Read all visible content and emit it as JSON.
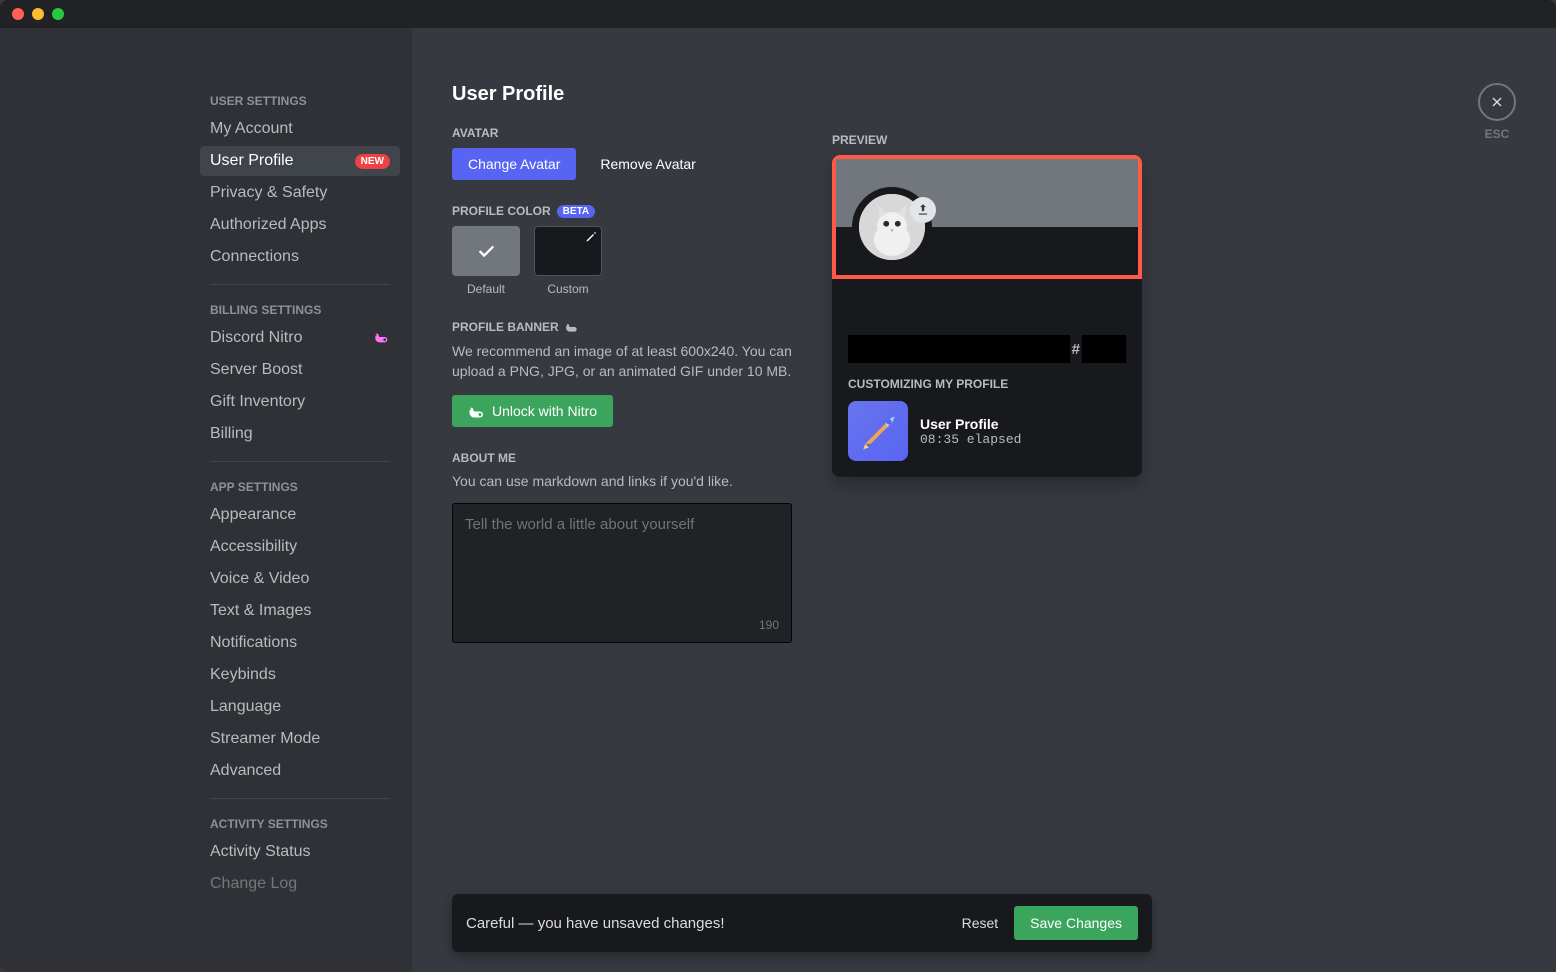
{
  "sidebar": {
    "sections": [
      {
        "header": "User Settings",
        "items": [
          {
            "label": "My Account",
            "key": "my-account"
          },
          {
            "label": "User Profile",
            "key": "user-profile",
            "selected": true,
            "badge": "NEW"
          },
          {
            "label": "Privacy & Safety",
            "key": "privacy-safety"
          },
          {
            "label": "Authorized Apps",
            "key": "authorized-apps"
          },
          {
            "label": "Connections",
            "key": "connections"
          }
        ]
      },
      {
        "header": "Billing Settings",
        "items": [
          {
            "label": "Discord Nitro",
            "key": "discord-nitro",
            "nitro": true
          },
          {
            "label": "Server Boost",
            "key": "server-boost"
          },
          {
            "label": "Gift Inventory",
            "key": "gift-inventory"
          },
          {
            "label": "Billing",
            "key": "billing"
          }
        ]
      },
      {
        "header": "App Settings",
        "items": [
          {
            "label": "Appearance",
            "key": "appearance"
          },
          {
            "label": "Accessibility",
            "key": "accessibility"
          },
          {
            "label": "Voice & Video",
            "key": "voice-video"
          },
          {
            "label": "Text & Images",
            "key": "text-images"
          },
          {
            "label": "Notifications",
            "key": "notifications"
          },
          {
            "label": "Keybinds",
            "key": "keybinds"
          },
          {
            "label": "Language",
            "key": "language"
          },
          {
            "label": "Streamer Mode",
            "key": "streamer-mode"
          },
          {
            "label": "Advanced",
            "key": "advanced"
          }
        ]
      },
      {
        "header": "Activity Settings",
        "items": [
          {
            "label": "Activity Status",
            "key": "activity-status"
          },
          {
            "label": "Change Log",
            "key": "change-log"
          }
        ]
      }
    ]
  },
  "page": {
    "title": "User Profile",
    "avatar_label": "Avatar",
    "change_avatar": "Change Avatar",
    "remove_avatar": "Remove Avatar",
    "profile_color_label": "Profile Color",
    "beta_badge": "BETA",
    "swatch_default": "Default",
    "swatch_custom": "Custom",
    "profile_banner_label": "Profile Banner",
    "banner_desc": "We recommend an image of at least 600x240. You can upload a PNG, JPG, or an animated GIF under 10 MB.",
    "unlock_nitro": "Unlock with Nitro",
    "about_me_label": "About Me",
    "about_me_desc": "You can use markdown and links if you'd like.",
    "about_me_placeholder": "Tell the world a little about yourself",
    "about_char_count": "190"
  },
  "preview": {
    "label": "Preview",
    "discriminator": "#",
    "customizing_label": "Customizing My Profile",
    "activity_title": "User Profile",
    "activity_time": "08:35 elapsed"
  },
  "close": {
    "esc": "ESC"
  },
  "unsaved": {
    "text": "Careful — you have unsaved changes!",
    "reset": "Reset",
    "save": "Save Changes"
  }
}
